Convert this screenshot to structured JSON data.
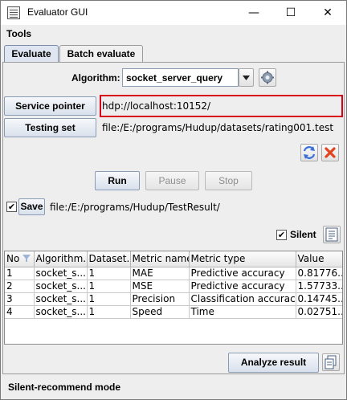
{
  "window": {
    "title": "Evaluator GUI",
    "minimize_glyph": "—",
    "maximize_glyph": "☐",
    "close_glyph": "✕"
  },
  "menu": {
    "tools": "Tools"
  },
  "tabs": [
    {
      "label": "Evaluate",
      "active": true
    },
    {
      "label": "Batch evaluate",
      "active": false
    }
  ],
  "algorithm": {
    "label": "Algorithm:",
    "selected": "socket_server_query"
  },
  "service_pointer": {
    "button": "Service pointer",
    "value": "hdp://localhost:10152/",
    "highlight_color": "#d9001b"
  },
  "testing_set": {
    "button": "Testing set",
    "value": "file:/E:/programs/Hudup/datasets/rating001.test"
  },
  "controls": {
    "run": "Run",
    "pause": "Pause",
    "stop": "Stop"
  },
  "save": {
    "label": "Save",
    "checked": true,
    "path": "file:/E:/programs/Hudup/TestResult/"
  },
  "silent": {
    "label": "Silent",
    "checked": true
  },
  "table": {
    "columns": [
      "No",
      "Algorithm...",
      "Dataset...",
      "Metric name",
      "Metric type",
      "Value"
    ],
    "rows": [
      [
        "1",
        "socket_s...",
        "1",
        "MAE",
        "Predictive accuracy",
        "0.81776..."
      ],
      [
        "2",
        "socket_s...",
        "1",
        "MSE",
        "Predictive accuracy",
        "1.57733..."
      ],
      [
        "3",
        "socket_s...",
        "1",
        "Precision",
        "Classification accuracy",
        "0.14745..."
      ],
      [
        "4",
        "socket_s...",
        "1",
        "Speed",
        "Time",
        "0.02751..."
      ]
    ]
  },
  "analyze_button": "Analyze result",
  "status_text": "Silent-recommend mode",
  "icons": {
    "app": "app-icon",
    "gear": "gear-icon",
    "refresh": "refresh-icon",
    "clear": "clear-icon",
    "report": "report-icon",
    "copy": "copy-icon",
    "filter": "filter-icon"
  },
  "colors": {
    "accent_blue": "#3a6fd8",
    "clear_red": "#e0451f"
  }
}
